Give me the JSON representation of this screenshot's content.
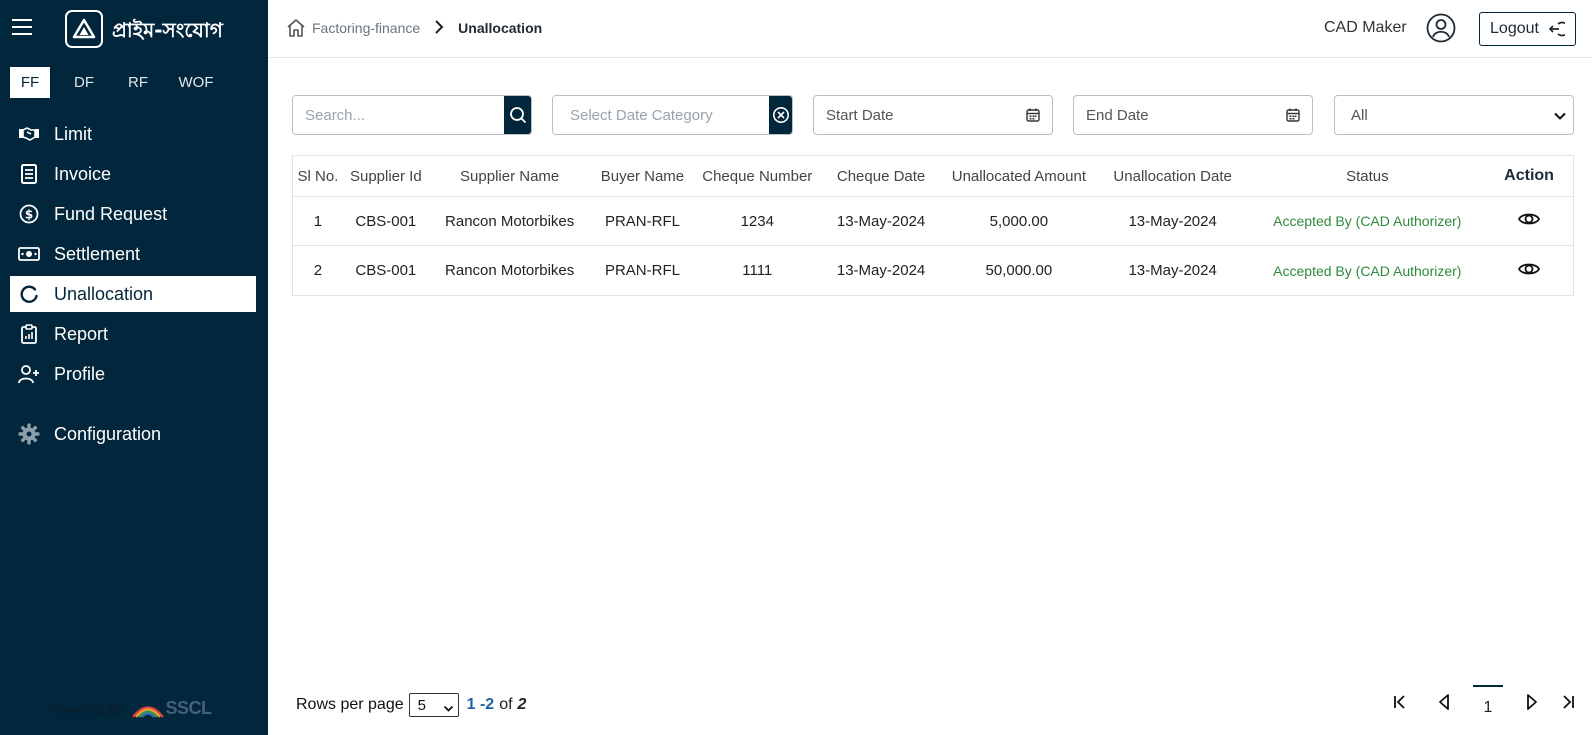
{
  "app": {
    "brand": "প্রাইম-সংযোগ",
    "powered_by": "Powered By",
    "powered_brand": "SSCL"
  },
  "tabs": [
    {
      "label": "FF",
      "active": true
    },
    {
      "label": "DF"
    },
    {
      "label": "RF"
    },
    {
      "label": "WOF"
    }
  ],
  "nav": {
    "limit": "Limit",
    "invoice": "Invoice",
    "fund_request": "Fund Request",
    "settlement": "Settlement",
    "unallocation": "Unallocation",
    "report": "Report",
    "profile": "Profile",
    "configuration": "Configuration"
  },
  "header": {
    "crumb_root": "Factoring-finance",
    "crumb_current": "Unallocation",
    "user": "CAD Maker",
    "logout": "Logout"
  },
  "filters": {
    "search_placeholder": "Search...",
    "date_category_placeholder": "Select Date Category",
    "start_date": "Start Date",
    "end_date": "End Date",
    "status_selected": "All"
  },
  "table": {
    "headers": {
      "sl": "Sl No.",
      "supplier_id": "Supplier Id",
      "supplier_name": "Supplier Name",
      "buyer_name": "Buyer Name",
      "cheque_number": "Cheque Number",
      "cheque_date": "Cheque Date",
      "amount": "Unallocated Amount",
      "unalloc_date": "Unallocation Date",
      "status": "Status",
      "action": "Action"
    },
    "rows": [
      {
        "sl": "1",
        "supplier_id": "CBS-001",
        "supplier_name": "Rancon Motorbikes",
        "buyer_name": "PRAN-RFL",
        "cheque_number": "1234",
        "cheque_date": "13-May-2024",
        "amount": "5,000.00",
        "unalloc_date": "13-May-2024",
        "status": "Accepted By (CAD Authorizer)"
      },
      {
        "sl": "2",
        "supplier_id": "CBS-001",
        "supplier_name": "Rancon Motorbikes",
        "buyer_name": "PRAN-RFL",
        "cheque_number": "1111",
        "cheque_date": "13-May-2024",
        "amount": "50,000.00",
        "unalloc_date": "13-May-2024",
        "status": "Accepted By (CAD Authorizer)"
      }
    ]
  },
  "pagination": {
    "rows_per_page_label": "Rows per page",
    "rows_per_page": "5",
    "range": "1 -2",
    "of": "of",
    "total": "2",
    "current_page": "1"
  },
  "colors": {
    "sidebar": "#02263b",
    "status_accepted": "#2f8a3c",
    "link": "#1f5fa3"
  }
}
